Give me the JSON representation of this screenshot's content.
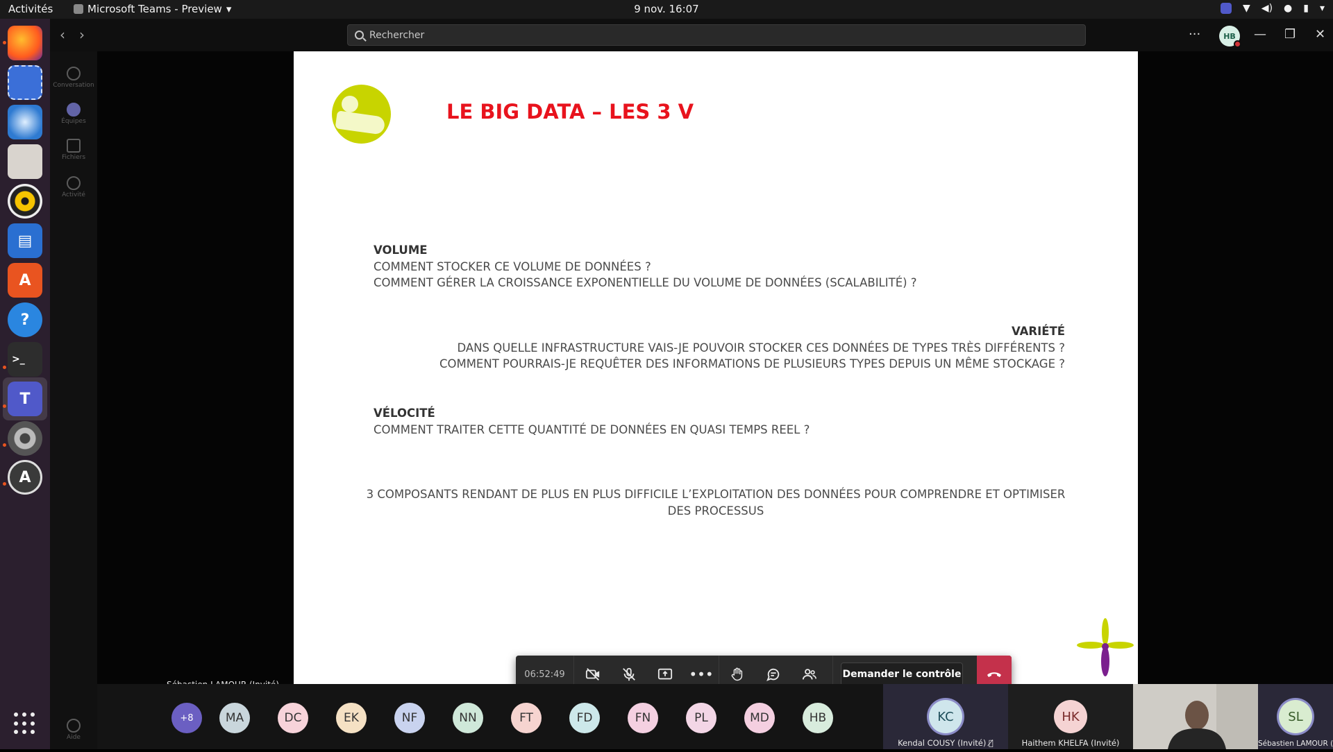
{
  "system_bar": {
    "activities": "Activités",
    "app_name": "Microsoft Teams - Preview",
    "datetime": "9 nov.  16:07"
  },
  "teams": {
    "search_placeholder": "Rechercher",
    "user_initials": "HB",
    "rail": [
      {
        "label": "Conversation",
        "icon": "chat-icon"
      },
      {
        "label": "Équipes",
        "icon": "teams-icon"
      },
      {
        "label": "Fichiers",
        "icon": "file-icon"
      },
      {
        "label": "Activité",
        "icon": "bell-icon"
      },
      {
        "label": "Aide",
        "icon": "help-icon"
      }
    ]
  },
  "slide": {
    "title": "LE BIG DATA – LES 3 V",
    "volume": {
      "heading": "VOLUME",
      "line1": "COMMENT STOCKER CE VOLUME DE DONNÉES ?",
      "line2": "COMMENT GÉRER LA CROISSANCE EXPONENTIELLE DU VOLUME DE DONNÉES (SCALABILITÉ) ?"
    },
    "variete": {
      "heading": "VARIÉTÉ",
      "line1": "DANS QUELLE INFRASTRUCTURE VAIS-JE POUVOIR STOCKER CES DONNÉES DE TYPES TRÈS DIFFÉRENTS ?",
      "line2": "COMMENT POURRAIS-JE REQUÊTER DES INFORMATIONS DE PLUSIEURS TYPES DEPUIS UN MÊME STOCKAGE ?"
    },
    "velocite": {
      "heading": "VÉLOCITÉ",
      "line1": "COMMENT TRAITER CETTE QUANTITÉ DE DONNÉES EN QUASI TEMPS REEL ?"
    },
    "conclusion": {
      "line1": "3 COMPOSANTS RENDANT DE PLUS EN PLUS DIFFICILE L’EXPLOITATION DES DONNÉES POUR COMPRENDRE ET OPTIMISER",
      "line2": "DES PROCESSUS"
    }
  },
  "meeting": {
    "timer": "06:52:49",
    "request_control": "Demander le contrôle",
    "presenter": "Sébastien LAMOUR (Invité)"
  },
  "participants": {
    "overflow": "+8",
    "avatars": [
      {
        "initials": "MA",
        "color": "#c9d6dc"
      },
      {
        "initials": "DC",
        "color": "#f7d3da"
      },
      {
        "initials": "EK",
        "color": "#f5e1c4"
      },
      {
        "initials": "NF",
        "color": "#c9d3ef"
      },
      {
        "initials": "NN",
        "color": "#cfe8d9"
      },
      {
        "initials": "FT",
        "color": "#f6d4d0"
      },
      {
        "initials": "FD",
        "color": "#cde8ea"
      },
      {
        "initials": "FN",
        "color": "#f4d0e1"
      },
      {
        "initials": "PL",
        "color": "#f3d6e6"
      },
      {
        "initials": "MD",
        "color": "#f4cfe0"
      },
      {
        "initials": "HB",
        "color": "#d8ecdd"
      }
    ],
    "tiles": [
      {
        "initials": "KC",
        "name": "Kendal COUSY (Invité)",
        "color": "#cfe6ec"
      },
      {
        "initials": "HK",
        "name": "Haithem KHELFA (Invité)",
        "color": "#f5d3d3"
      },
      {
        "initials": "SL",
        "name": "Sébastien LAMOUR (Invité)",
        "color": "#d9ecd0"
      }
    ]
  }
}
